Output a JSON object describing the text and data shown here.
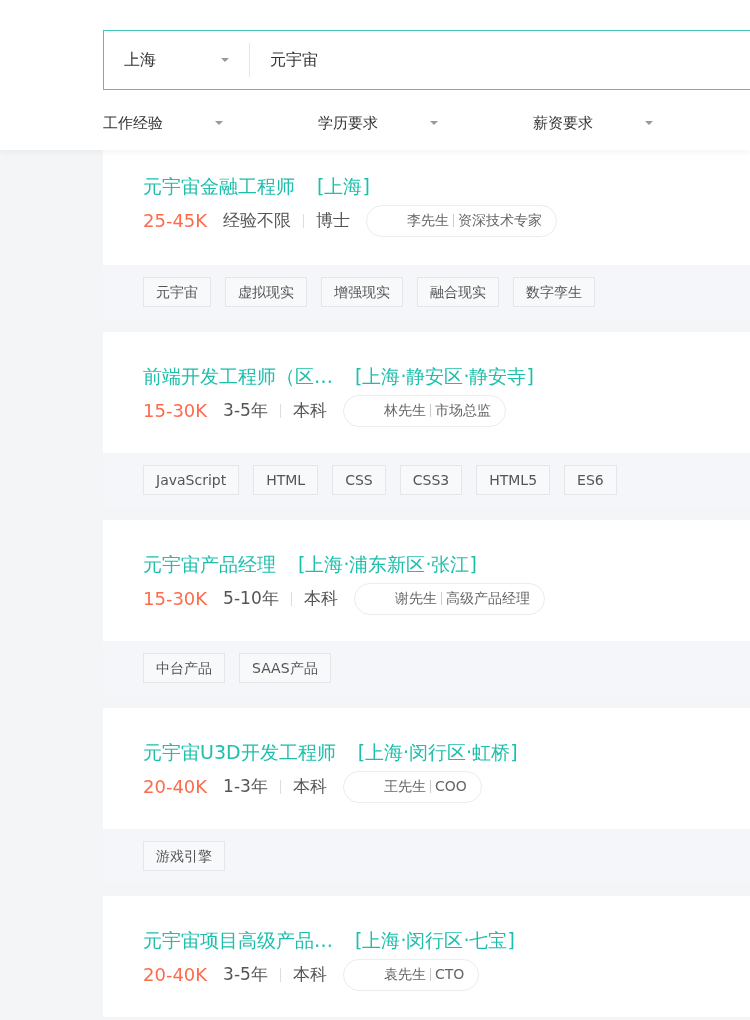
{
  "search": {
    "city": "上海",
    "keyword": "元宇宙"
  },
  "filters": [
    "工作经验",
    "学历要求",
    "薪资要求"
  ],
  "jobs": [
    {
      "title": "元宇宙金融工程师",
      "location": "[上海]",
      "salary": "25-45K",
      "experience": "经验不限",
      "education": "博士",
      "recruiter_name": "李先生",
      "recruiter_title": "资深技术专家",
      "tags": [
        "元宇宙",
        "虚拟现实",
        "增强现实",
        "融合现实",
        "数字孪生"
      ]
    },
    {
      "title": "前端开发工程师（区…",
      "location": "[上海·静安区·静安寺]",
      "salary": "15-30K",
      "experience": "3-5年",
      "education": "本科",
      "recruiter_name": "林先生",
      "recruiter_title": "市场总监",
      "tags": [
        "JavaScript",
        "HTML",
        "CSS",
        "CSS3",
        "HTML5",
        "ES6"
      ]
    },
    {
      "title": "元宇宙产品经理",
      "location": "[上海·浦东新区·张江]",
      "salary": "15-30K",
      "experience": "5-10年",
      "education": "本科",
      "recruiter_name": "谢先生",
      "recruiter_title": "高级产品经理",
      "tags": [
        "中台产品",
        "SAAS产品"
      ]
    },
    {
      "title": "元宇宙U3D开发工程师",
      "location": "[上海·闵行区·虹桥]",
      "salary": "20-40K",
      "experience": "1-3年",
      "education": "本科",
      "recruiter_name": "王先生",
      "recruiter_title": "COO",
      "tags": [
        "游戏引擎"
      ]
    },
    {
      "title": "元宇宙项目高级产品…",
      "location": "[上海·闵行区·七宝]",
      "salary": "20-40K",
      "experience": "3-5年",
      "education": "本科",
      "recruiter_name": "袁先生",
      "recruiter_title": "CTO"
    }
  ]
}
